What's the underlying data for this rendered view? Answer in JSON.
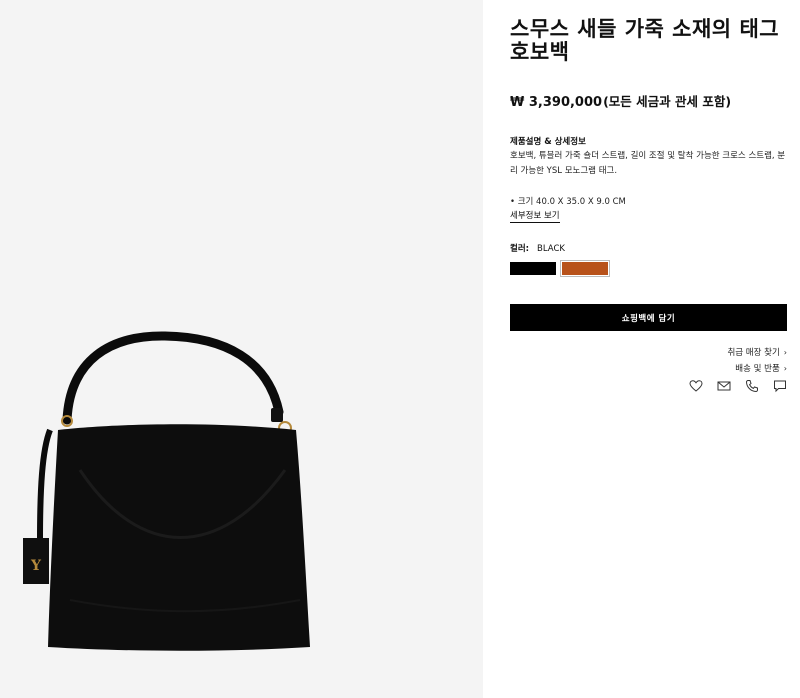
{
  "product": {
    "title": "스무스 새들 가죽 소재의 태그 호보백",
    "price": "₩ 3,390,000",
    "price_note": "(모든 세금과 관세 포함)",
    "description_heading": "제품설명 & 상세정보",
    "description": "호보백, 튜블러 가죽 숄더 스트랩, 길이 조절 및 탈착 가능한 크로스 스트랩, 분리 가능한 YSL 모노그램 태그.",
    "size": "• 크기 40.0 X 35.0 X 9.0 CM",
    "more_details_link": "세부정보 보기",
    "color_label": "컬러:",
    "color_value": "BLACK",
    "swatches": [
      {
        "name": "black",
        "color": "#000000"
      },
      {
        "name": "brown",
        "color": "#b8521a"
      }
    ],
    "add_to_bag": "쇼핑백에 담기"
  },
  "links": {
    "find_store": "취급 매장 찾기",
    "shipping_returns": "배송 및 반품"
  },
  "icons": [
    "heart-icon",
    "mail-icon",
    "phone-icon",
    "chat-icon"
  ],
  "colors": {
    "image_bg": "#f4f4f4",
    "button_bg": "#000000",
    "button_text": "#ffffff"
  }
}
